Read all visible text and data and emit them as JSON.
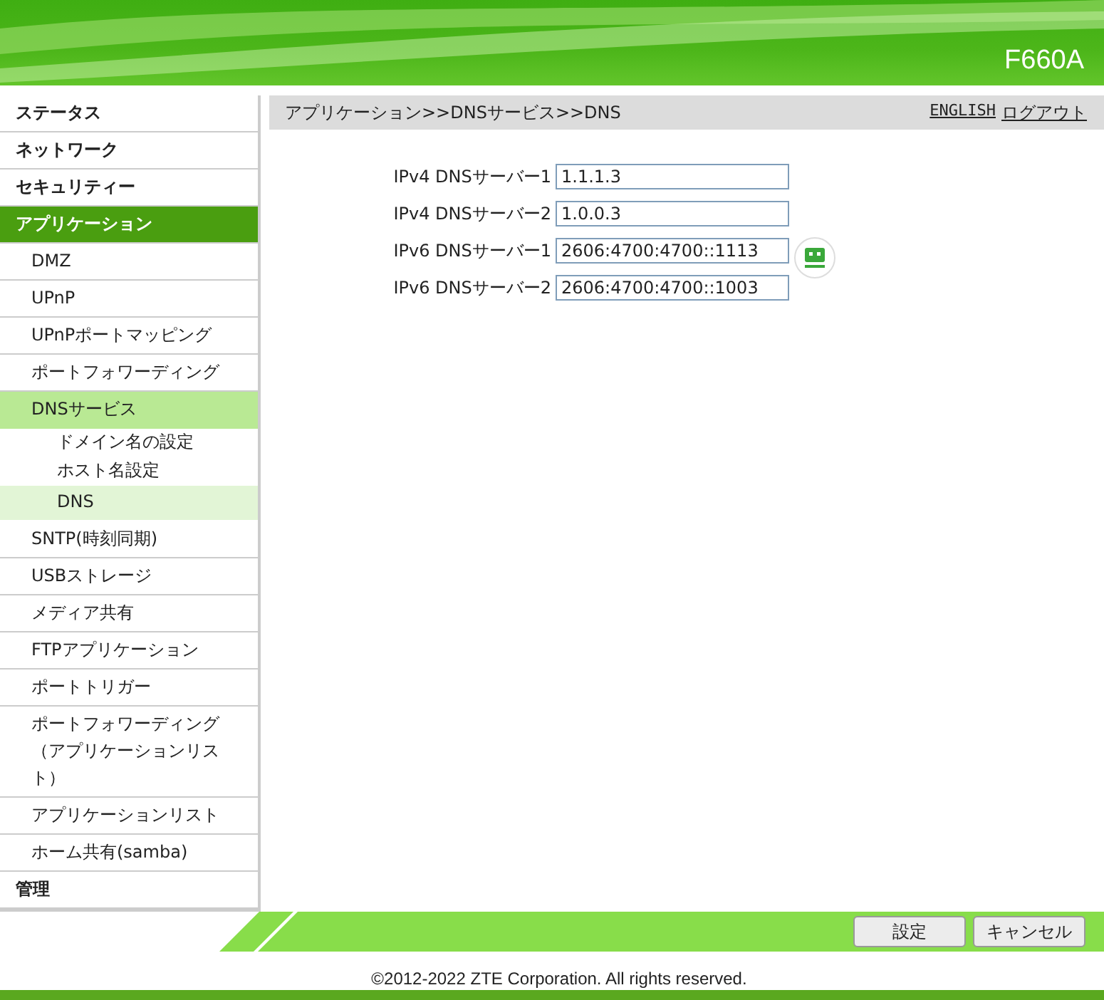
{
  "header": {
    "model": "F660A"
  },
  "sidebar": {
    "items": [
      {
        "label": "ステータス",
        "selected": false
      },
      {
        "label": "ネットワーク",
        "selected": false
      },
      {
        "label": "セキュリティー",
        "selected": false
      },
      {
        "label": "アプリケーション",
        "selected": true,
        "children": [
          {
            "label": "DMZ",
            "selected": false
          },
          {
            "label": "UPnP",
            "selected": false
          },
          {
            "label": "UPnPポートマッピング",
            "selected": false
          },
          {
            "label": "ポートフォワーディング",
            "selected": false
          },
          {
            "label": "DNSサービス",
            "selected": true,
            "children": [
              {
                "label": "ドメイン名の設定",
                "selected": false
              },
              {
                "label": "ホスト名設定",
                "selected": false
              },
              {
                "label": "DNS",
                "selected": true
              }
            ]
          },
          {
            "label": "SNTP(時刻同期)",
            "selected": false
          },
          {
            "label": "USBストレージ",
            "selected": false
          },
          {
            "label": "メディア共有",
            "selected": false
          },
          {
            "label": "FTPアプリケーション",
            "selected": false
          },
          {
            "label": "ポートトリガー",
            "selected": false
          },
          {
            "label": "ポートフォワーディング（アプリケーションリスト）",
            "selected": false
          },
          {
            "label": "アプリケーションリスト",
            "selected": false
          },
          {
            "label": "ホーム共有(samba)",
            "selected": false
          }
        ]
      },
      {
        "label": "管理",
        "selected": false
      }
    ]
  },
  "breadcrumb": "アプリケーション>>DNSサービス>>DNS",
  "links": [
    "ENGLISH",
    "ログアウト"
  ],
  "fields": [
    {
      "label": "IPv4 DNSサーバー1",
      "value": "1.1.1.3"
    },
    {
      "label": "IPv4 DNSサーバー2",
      "value": "1.0.0.3"
    },
    {
      "label": "IPv6 DNSサーバー1",
      "value": "2606:4700:4700::1113"
    },
    {
      "label": "IPv6 DNSサーバー2",
      "value": "2606:4700:4700::1003"
    }
  ],
  "buttons": [
    "設定",
    "キャンセル"
  ],
  "footer": "©2012-2022 ZTE Corporation. All rights reserved."
}
